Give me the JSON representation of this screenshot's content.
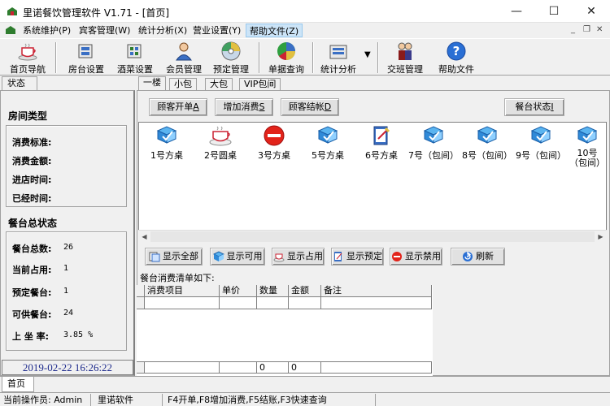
{
  "window": {
    "title": "里诺餐饮管理软件 V1.71 - [首页]",
    "min_symbol": "—",
    "max_symbol": "☐",
    "close_symbol": "✕",
    "mdi_min": "_",
    "mdi_restore": "❐",
    "mdi_close": "✕"
  },
  "menu": [
    {
      "label": "系统维护(P)"
    },
    {
      "label": "宾客管理(W)"
    },
    {
      "label": "统计分析(X)"
    },
    {
      "label": "营业设置(Y)"
    },
    {
      "label": "帮助文件(Z)"
    }
  ],
  "toolbar": [
    {
      "label": "首页导航",
      "icon": "coffee-cup-icon"
    },
    {
      "label": "房台设置",
      "icon": "room-setup-icon"
    },
    {
      "label": "酒菜设置",
      "icon": "dish-setup-icon"
    },
    {
      "label": "会员管理",
      "icon": "member-icon"
    },
    {
      "label": "预定管理",
      "icon": "reservation-cd-icon"
    },
    {
      "label": "单据查询",
      "icon": "pie-chart-icon"
    },
    {
      "label": "统计分析",
      "icon": "statistics-icon"
    },
    {
      "label": "交班管理",
      "icon": "people-icon"
    },
    {
      "label": "帮助文件",
      "icon": "help-icon"
    }
  ],
  "left": {
    "tab_label": "状态",
    "room_type": {
      "title": "房间类型",
      "fields": [
        {
          "label": "消费标准:",
          "value": ""
        },
        {
          "label": "消费金额:",
          "value": ""
        },
        {
          "label": "进店时间:",
          "value": ""
        },
        {
          "label": "已经时间:",
          "value": ""
        }
      ]
    },
    "overall": {
      "title": "餐台总状态",
      "fields": [
        {
          "label": "餐台总数:",
          "value": "26"
        },
        {
          "label": "当前占用:",
          "value": "1"
        },
        {
          "label": "预定餐台:",
          "value": "1"
        },
        {
          "label": "可供餐台:",
          "value": "24"
        },
        {
          "label": "上 坐 率:",
          "value": "3.85 %"
        }
      ]
    },
    "clock": "2019-02-22 16:26:22"
  },
  "tabs": [
    {
      "label": "一楼",
      "selected": true
    },
    {
      "label": "小包"
    },
    {
      "label": "大包"
    },
    {
      "label": "VIP包间"
    }
  ],
  "actions": [
    {
      "text": "顾客开单",
      "key": "A"
    },
    {
      "text": "增加消费",
      "key": "S"
    },
    {
      "text": "顾客结帐",
      "key": "D"
    }
  ],
  "status_button": {
    "text": "餐台状态",
    "key": "I"
  },
  "tables": [
    {
      "label": "1号方桌",
      "state": "available",
      "icon": "table-available-icon"
    },
    {
      "label": "2号圆桌",
      "state": "reserved",
      "icon": "teacup-icon"
    },
    {
      "label": "3号方桌",
      "state": "occupied",
      "icon": "no-entry-icon"
    },
    {
      "label": "5号方桌",
      "state": "available",
      "icon": "table-available-icon"
    },
    {
      "label": "6号方桌",
      "state": "disabled",
      "icon": "clipboard-icon"
    },
    {
      "label": "7号（包间）",
      "state": "available",
      "icon": "table-available-icon"
    },
    {
      "label": "8号（包间）",
      "state": "available",
      "icon": "table-available-icon"
    },
    {
      "label": "9号（包间）",
      "state": "available",
      "icon": "table-available-icon"
    },
    {
      "label": "10号（包间）",
      "state": "available",
      "icon": "table-available-icon"
    }
  ],
  "filters": [
    {
      "label": "显示全部",
      "icon": "show-all-icon"
    },
    {
      "label": "显示可用",
      "icon": "show-available-icon"
    },
    {
      "label": "显示占用",
      "icon": "show-occupied-icon"
    },
    {
      "label": "显示预定",
      "icon": "show-reserved-icon"
    },
    {
      "label": "显示禁用",
      "icon": "show-disabled-icon"
    },
    {
      "label": "刷新",
      "icon": "refresh-icon"
    }
  ],
  "bill": {
    "caption": "餐台消费清单如下:",
    "columns": [
      "消费项目",
      "单价",
      "数量",
      "金额",
      "备注"
    ],
    "total_qty": "0",
    "total_amount": "0"
  },
  "bottom_tab": "首页",
  "status": {
    "operator": "当前操作员: Admin",
    "company": "里诺软件",
    "hotkeys": "F4开单,F8增加消费,F5结账,F3快速查询"
  },
  "colors": {
    "accent_blue": "#1d2a8c",
    "no_entry_red": "#e2231a",
    "menu_highlight": "#cce4f7"
  }
}
